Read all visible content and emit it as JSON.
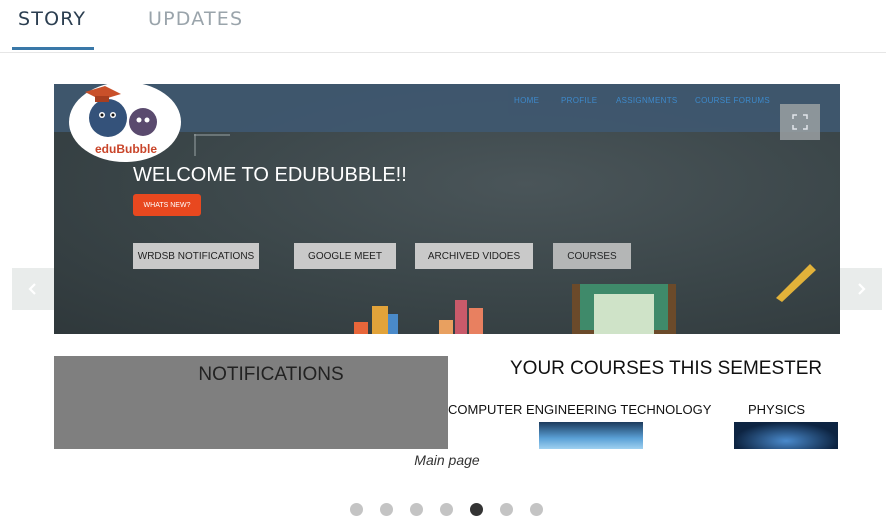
{
  "tabs": [
    {
      "label": "STORY",
      "active": true
    },
    {
      "label": "UPDATES",
      "active": false
    }
  ],
  "slide": {
    "nav_links": [
      "HOME",
      "PROFILE",
      "ASSIGNMENTS",
      "COURSE FORUMS",
      ""
    ],
    "logo_text": "eduBubble",
    "welcome": "WELCOME TO EDUBUBBLE!!",
    "whats_new": "WHATS NEW?",
    "buttons": [
      "WRDSB NOTIFICATIONS",
      "GOOGLE MEET",
      "ARCHIVED VIDOES",
      "COURSES"
    ],
    "notifications_title": "NOTIFICATIONS",
    "courses_title": "YOUR COURSES THIS SEMESTER",
    "courses": [
      "COMPUTER ENGINEERING TECHNOLOGY",
      "PHYSICS"
    ]
  },
  "caption": "Main page",
  "pagination": {
    "total": 7,
    "active_index": 4
  },
  "colors": {
    "accent": "#3a78a8",
    "orange": "#e8481f",
    "chalkboard": "#3a4548"
  },
  "icons": {
    "fullscreen": "fullscreen-icon",
    "prev": "chevron-left-icon",
    "next": "chevron-right-icon"
  }
}
